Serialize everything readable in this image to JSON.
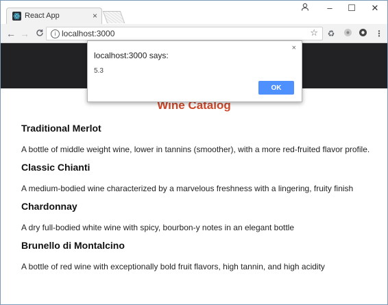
{
  "browser": {
    "tab_title": "React App",
    "tab_close": "×",
    "url": "localhost:3000",
    "window_controls": {
      "minimize": "–",
      "maximize": "☐",
      "close": "✕"
    },
    "profile_icon": "person-icon",
    "nav": {
      "back": "←",
      "forward": "→",
      "reload": "C"
    },
    "star": "☆",
    "extensions": [
      "recycle-icon",
      "extension-icon",
      "chrome-icon"
    ],
    "menu": "⋮"
  },
  "page": {
    "title": "Wine Catalog",
    "header_color": "#222225",
    "accent_color": "#d0482a",
    "wines": [
      {
        "name": "Traditional Merlot",
        "description": "A bottle of middle weight wine, lower in tannins (smoother), with a more red-fruited flavor profile."
      },
      {
        "name": "Classic Chianti",
        "description": "A medium-bodied wine characterized by a marvelous freshness with a lingering, fruity finish"
      },
      {
        "name": "Chardonnay",
        "description": "A dry full-bodied white wine with spicy, bourbon-y notes in an elegant bottle"
      },
      {
        "name": "Brunello di Montalcino",
        "description": "A bottle of red wine with exceptionally bold fruit flavors, high tannin, and high acidity"
      }
    ]
  },
  "alert": {
    "title": "localhost:3000 says:",
    "message": "5.3",
    "ok_label": "OK",
    "close": "×"
  }
}
